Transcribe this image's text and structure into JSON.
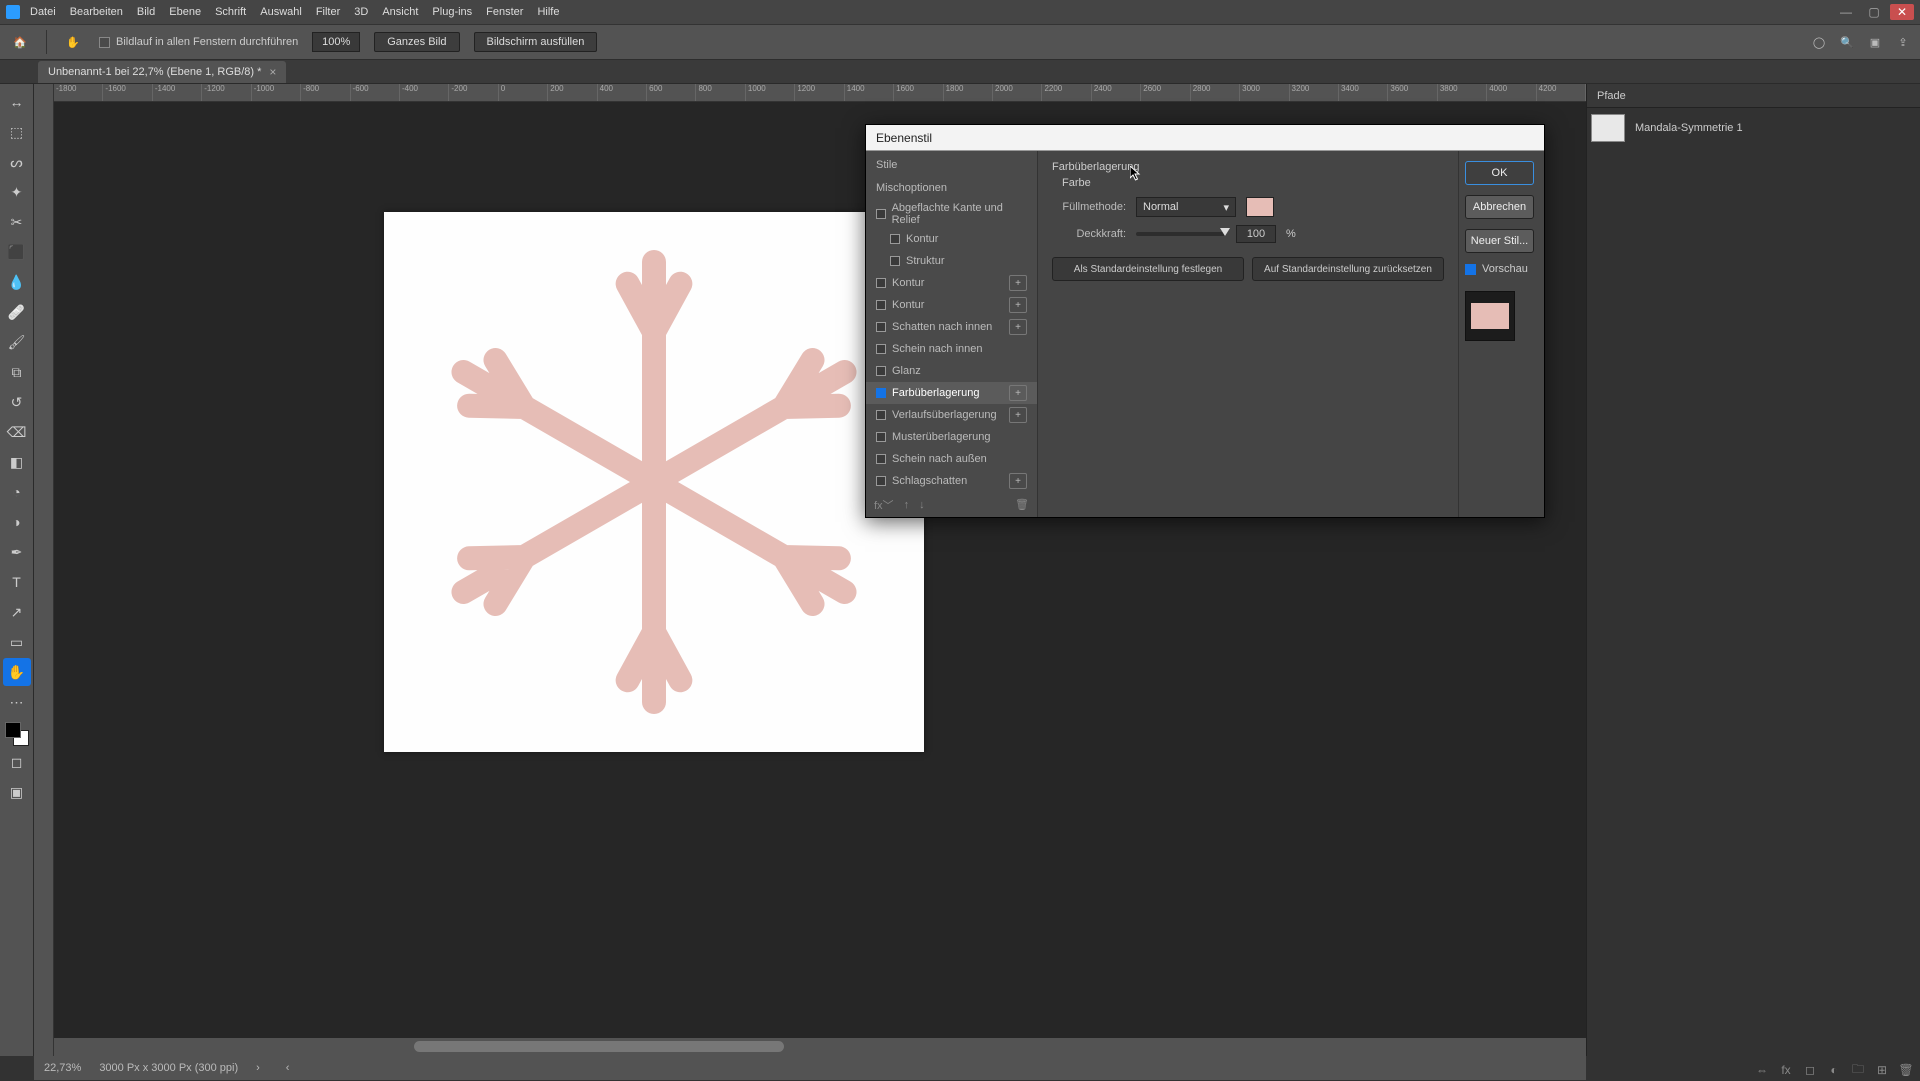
{
  "accent_pink": "#e6bdb6",
  "menu": {
    "items": [
      "Datei",
      "Bearbeiten",
      "Bild",
      "Ebene",
      "Schrift",
      "Auswahl",
      "Filter",
      "3D",
      "Ansicht",
      "Plug-ins",
      "Fenster",
      "Hilfe"
    ]
  },
  "options": {
    "scroll_check": "Bildlauf in allen Fenstern durchführen",
    "zoom": "100%",
    "fit_all": "Ganzes Bild",
    "fit_screen": "Bildschirm ausfüllen"
  },
  "doc_tab": "Unbenannt-1 bei 22,7% (Ebene 1, RGB/8) *",
  "ruler": [
    "-1800",
    "-1600",
    "-1400",
    "-1200",
    "-1000",
    "-800",
    "-600",
    "-400",
    "-200",
    "0",
    "200",
    "400",
    "600",
    "800",
    "1000",
    "1200",
    "1400",
    "1600",
    "1800",
    "2000",
    "2200",
    "2400",
    "2600",
    "2800",
    "3000",
    "3200",
    "3400",
    "3600",
    "3800",
    "4000",
    "4200"
  ],
  "panel": {
    "paths_tab": "Pfade",
    "path_item": "Mandala-Symmetrie 1"
  },
  "dialog": {
    "title": "Ebenenstil",
    "list_head": "Stile",
    "blend": "Mischoptionen",
    "items": {
      "bevel": "Abgeflachte Kante und Relief",
      "kontur_sub": "Kontur",
      "struktur": "Struktur",
      "kontur": "Kontur",
      "kontur2": "Kontur",
      "inner_shadow": "Schatten nach innen",
      "inner_glow": "Schein nach innen",
      "satin": "Glanz",
      "color_overlay": "Farbüberlagerung",
      "gradient_overlay": "Verlaufsüberlagerung",
      "pattern_overlay": "Musterüberlagerung",
      "outer_glow": "Schein nach außen",
      "drop_shadow": "Schlagschatten"
    },
    "effect": {
      "heading": "Farbüberlagerung",
      "sub": "Farbe",
      "mode_label": "Füllmethode:",
      "mode_value": "Normal",
      "opacity_label": "Deckkraft:",
      "opacity_value": "100",
      "opacity_unit": "%",
      "default_set": "Als Standardeinstellung festlegen",
      "default_reset": "Auf Standardeinstellung zurücksetzen"
    },
    "buttons": {
      "ok": "OK",
      "cancel": "Abbrechen",
      "new_style": "Neuer Stil..."
    },
    "preview": "Vorschau"
  },
  "footer": {
    "zoom": "22,73%",
    "info": "3000 Px x 3000 Px (300 ppi)"
  },
  "tools": [
    "move",
    "artboard",
    "lasso",
    "wand",
    "crop",
    "frame",
    "eyedrop",
    "retouch",
    "brush",
    "stamp",
    "history",
    "eraser",
    "gradient",
    "blur",
    "dodge",
    "pen",
    "type",
    "path",
    "rect",
    "hand"
  ]
}
